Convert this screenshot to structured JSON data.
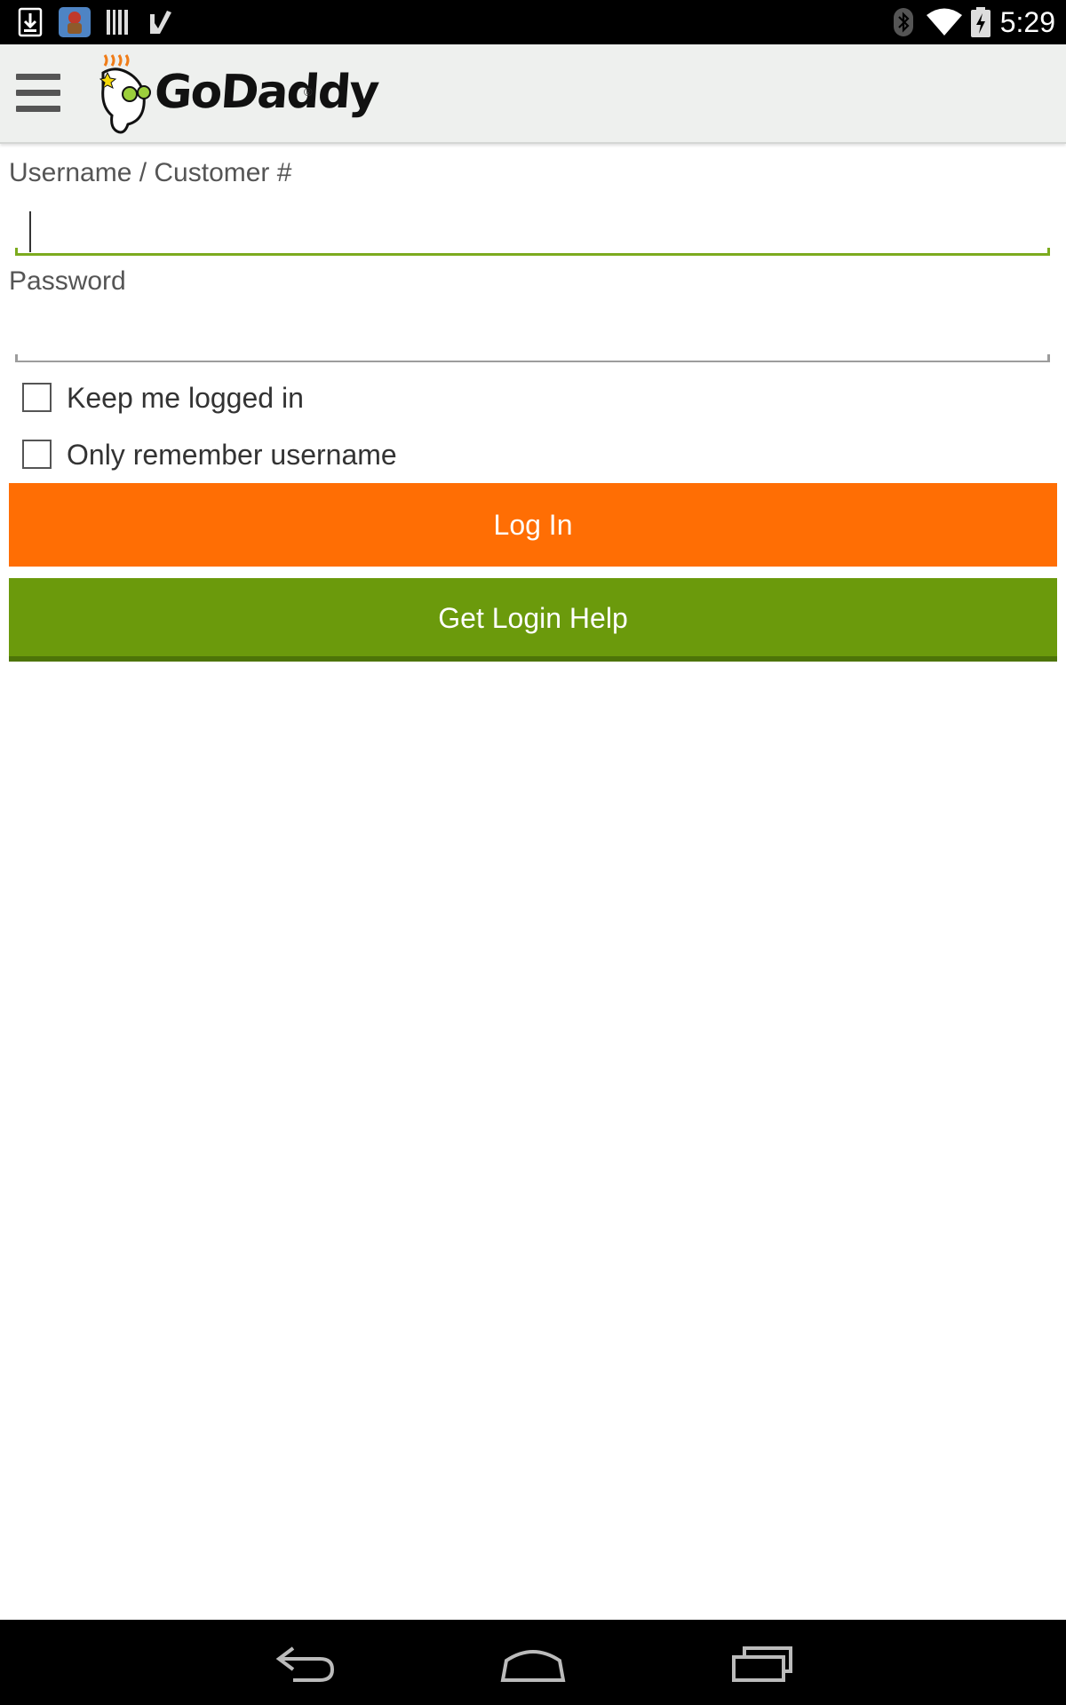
{
  "status_bar": {
    "time": "5:29",
    "icons": [
      "download-icon",
      "app-notification-icon",
      "barcode-icon",
      "check-icon",
      "bluetooth-icon",
      "wifi-icon",
      "battery-icon"
    ]
  },
  "app_bar": {
    "logo_text": "GoDaddy",
    "logo_registered": "®"
  },
  "form": {
    "username_label": "Username / Customer #",
    "username_value": "",
    "password_label": "Password",
    "password_value": "",
    "keep_logged_in_label": "Keep me logged in",
    "keep_logged_in_checked": false,
    "remember_username_label": "Only remember username",
    "remember_username_checked": false
  },
  "buttons": {
    "login_label": "Log In",
    "help_label": "Get Login Help"
  },
  "colors": {
    "login_button": "#ff6e04",
    "help_button": "#6b9a0c",
    "focus_underline": "#7cab1e"
  },
  "nav_bar": {
    "icons": [
      "back-icon",
      "home-icon",
      "recents-icon"
    ]
  }
}
